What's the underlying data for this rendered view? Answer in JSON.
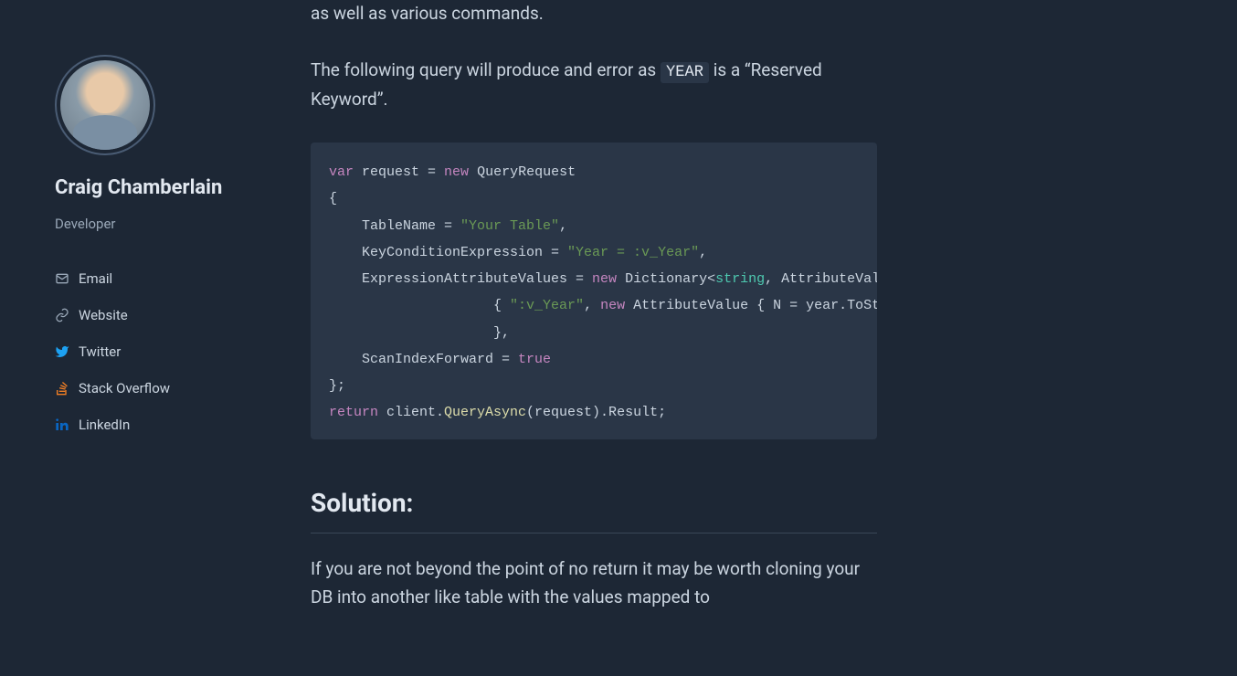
{
  "sidebar": {
    "name": "Craig Chamberlain",
    "role": "Developer",
    "links": [
      {
        "label": "Email",
        "icon": "mail-icon",
        "color": "#9aa8b8"
      },
      {
        "label": "Website",
        "icon": "link-icon",
        "color": "#9aa8b8"
      },
      {
        "label": "Twitter",
        "icon": "twitter-icon",
        "color": "#1da1f2"
      },
      {
        "label": "Stack Overflow",
        "icon": "stackoverflow-icon",
        "color": "#f48024"
      },
      {
        "label": "LinkedIn",
        "icon": "linkedin-icon",
        "color": "#0a66c2"
      }
    ]
  },
  "article": {
    "intro_fragment": "as well as various commands.",
    "para1_a": "The following query will produce and error as ",
    "para1_code": "YEAR",
    "para1_b": " is a “Reserved Keyword”.",
    "solution_heading": "Solution:",
    "para2": "If you are not beyond the point of no return it may be worth cloning your DB into another like table with the values mapped to"
  },
  "code": {
    "tokens": [
      {
        "t": "var",
        "c": "kw"
      },
      {
        "t": " request = "
      },
      {
        "t": "new",
        "c": "kw"
      },
      {
        "t": " QueryRequest\n{\n    TableName = "
      },
      {
        "t": "\"Your Table\"",
        "c": "str"
      },
      {
        "t": ",\n    KeyConditionExpression = "
      },
      {
        "t": "\"Year = :v_Year\"",
        "c": "str"
      },
      {
        "t": ",\n    ExpressionAttributeValues = "
      },
      {
        "t": "new",
        "c": "kw"
      },
      {
        "t": " Dictionary<"
      },
      {
        "t": "string",
        "c": "type"
      },
      {
        "t": ", AttributeValue>\n                    { "
      },
      {
        "t": "\":v_Year\"",
        "c": "str"
      },
      {
        "t": ", "
      },
      {
        "t": "new",
        "c": "kw"
      },
      {
        "t": " AttributeValue { N = year.ToString() }\n                    },\n    ScanIndexForward = "
      },
      {
        "t": "true",
        "c": "bool"
      },
      {
        "t": "\n};\n"
      },
      {
        "t": "return",
        "c": "kw"
      },
      {
        "t": " client."
      },
      {
        "t": "QueryAsync",
        "c": "fn"
      },
      {
        "t": "(request).Result;"
      }
    ]
  }
}
